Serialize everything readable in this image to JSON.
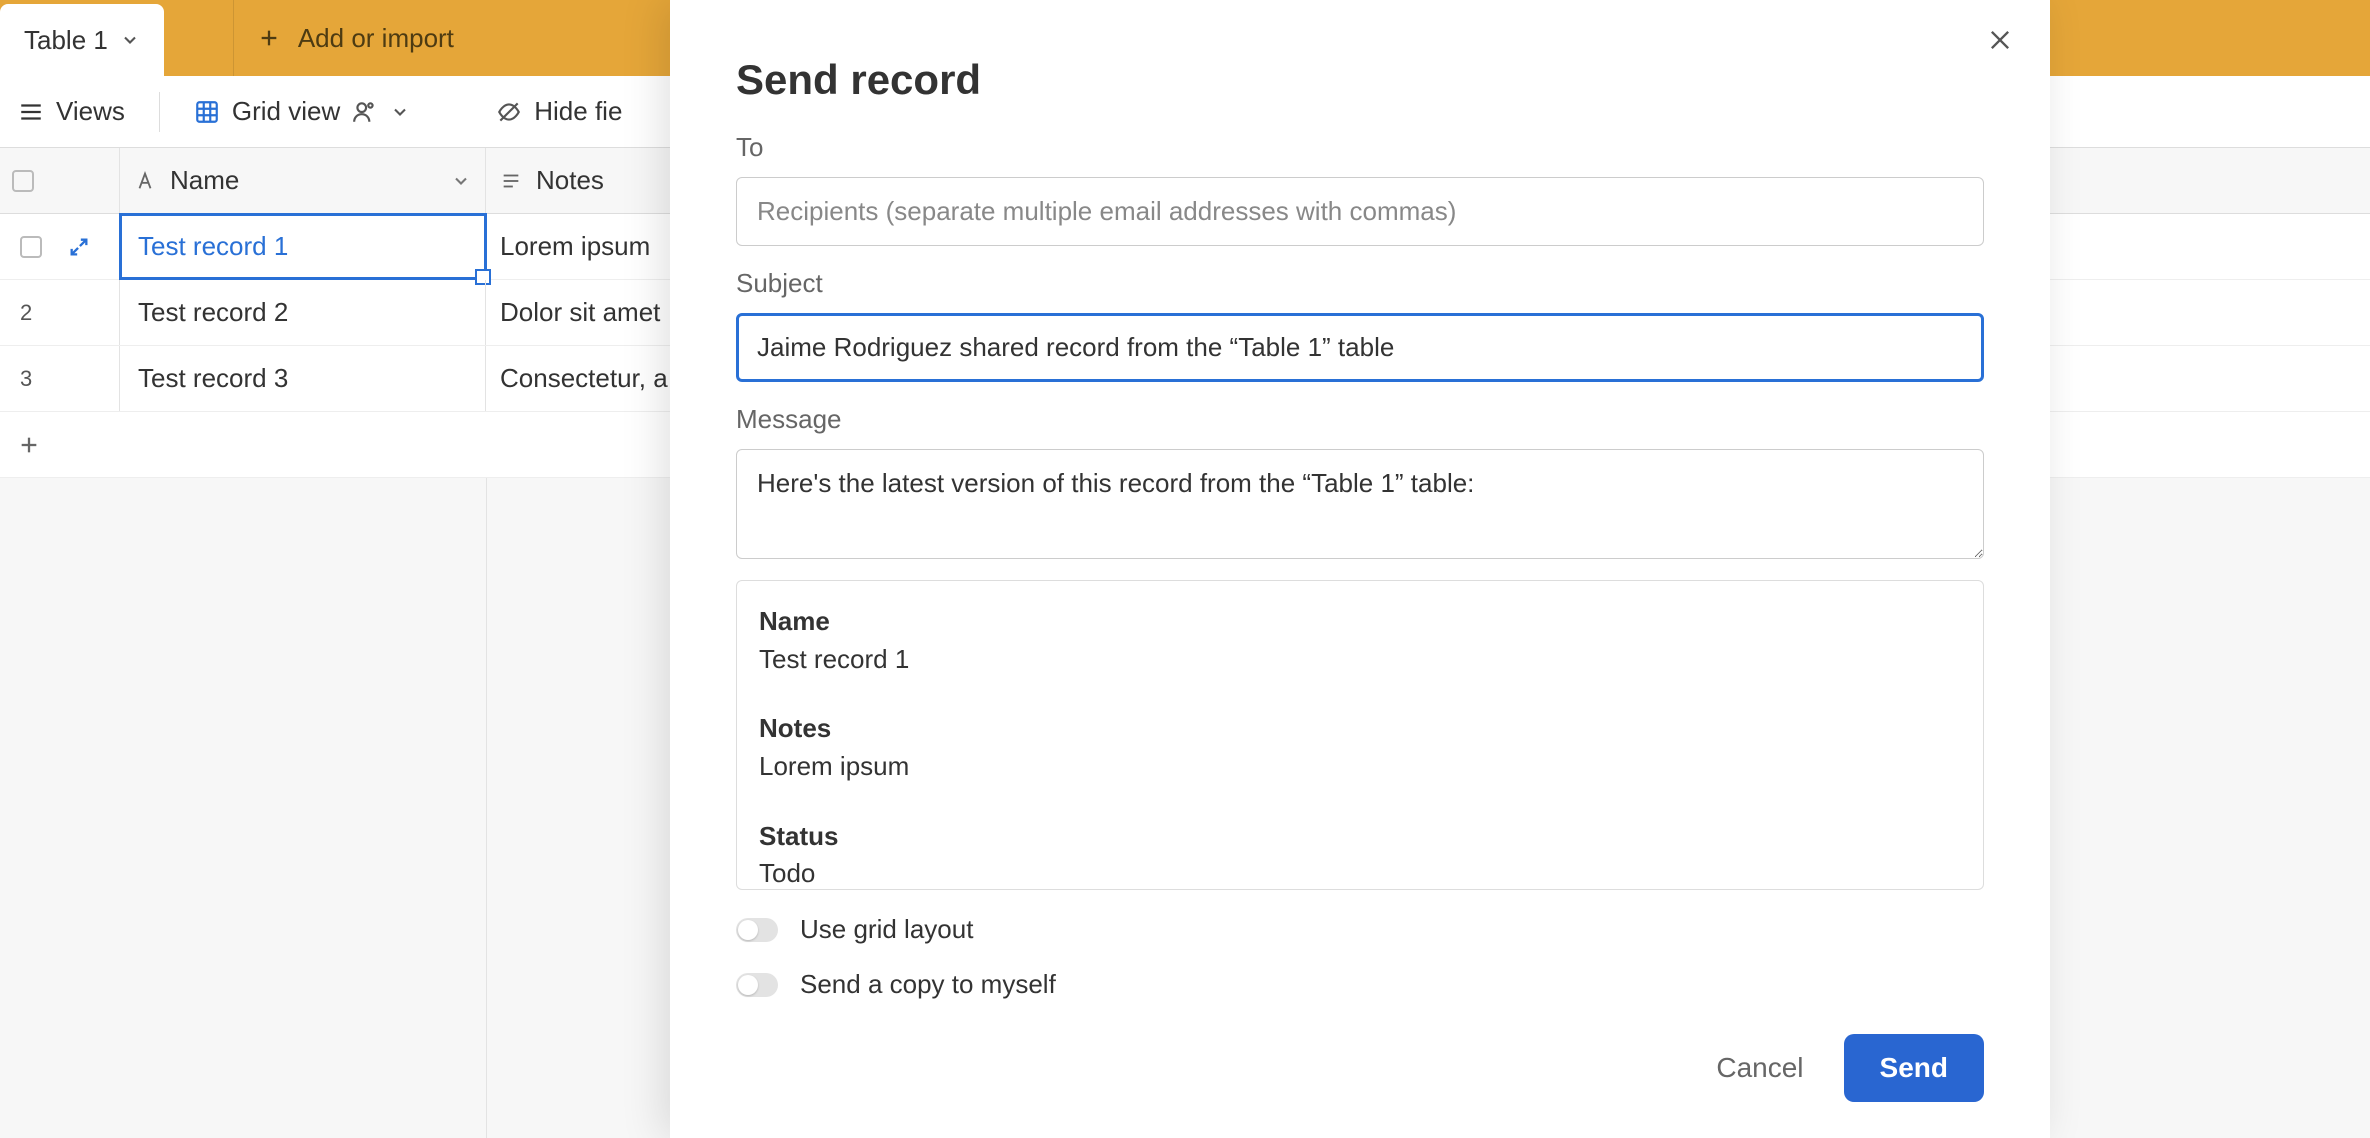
{
  "tabs": {
    "active": "Table 1",
    "add_label": "Add or import"
  },
  "toolbar": {
    "views": "Views",
    "grid_view": "Grid view",
    "hide_fields": "Hide fie"
  },
  "grid": {
    "columns": {
      "name": "Name",
      "notes": "Notes"
    },
    "rows": [
      {
        "num": "",
        "name": "Test record 1",
        "notes": "Lorem ipsum",
        "selected": true
      },
      {
        "num": "2",
        "name": "Test record 2",
        "notes": "Dolor sit amet",
        "selected": false
      },
      {
        "num": "3",
        "name": "Test record 3",
        "notes": "Consectetur, a",
        "selected": false
      }
    ]
  },
  "modal": {
    "title": "Send record",
    "to_label": "To",
    "to_placeholder": "Recipients (separate multiple email addresses with commas)",
    "subject_label": "Subject",
    "subject_value": "Jaime Rodriguez shared record from the “Table 1” table",
    "message_label": "Message",
    "message_value": "Here's the latest version of this record from the “Table 1” table:",
    "preview": [
      {
        "label": "Name",
        "value": "Test record 1"
      },
      {
        "label": "Notes",
        "value": "Lorem ipsum"
      },
      {
        "label": "Status",
        "value": "Todo"
      }
    ],
    "toggles": {
      "grid_layout": "Use grid layout",
      "copy_myself": "Send a copy to myself"
    },
    "actions": {
      "cancel": "Cancel",
      "send": "Send"
    }
  }
}
